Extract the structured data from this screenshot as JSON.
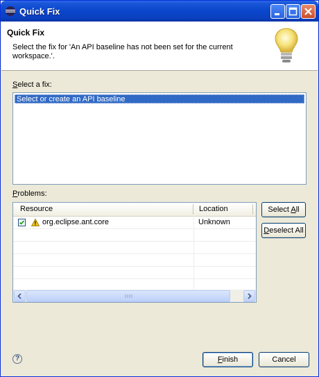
{
  "window": {
    "title": "Quick Fix",
    "icon": "eclipse-icon"
  },
  "titlebar_buttons": {
    "minimize": "minimize-icon",
    "maximize": "maximize-icon",
    "close": "close-icon"
  },
  "header": {
    "title": "Quick Fix",
    "message": "Select the fix for 'An API baseline has not been set for the current workspace.'.",
    "icon": "lightbulb-icon"
  },
  "fixes": {
    "label_mnemonic": "S",
    "label_rest": "elect a fix:",
    "items": [
      {
        "label": "Select or create an API baseline",
        "selected": true
      }
    ]
  },
  "problems": {
    "label_mnemonic": "P",
    "label_rest": "roblems:",
    "columns": [
      "Resource",
      "Location"
    ],
    "rows": [
      {
        "checked": true,
        "icon": "warning-icon",
        "resource": "org.eclipse.ant.core",
        "location": "Unknown"
      }
    ]
  },
  "buttons": {
    "select_all_pre": "Select ",
    "select_all_mn": "A",
    "select_all_post": "ll",
    "deselect_all_mn": "D",
    "deselect_all_post": "eselect All",
    "finish_mn": "F",
    "finish_post": "inish",
    "cancel": "Cancel"
  },
  "colors": {
    "selection": "#316ac5",
    "titlebar": "#0a46cc",
    "dialog_bg": "#ece9d8"
  }
}
